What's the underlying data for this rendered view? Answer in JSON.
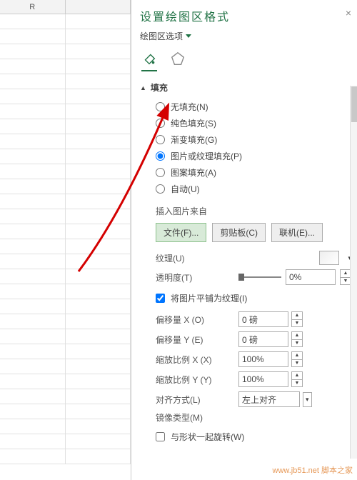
{
  "sheet": {
    "col_r": "R"
  },
  "pane": {
    "title": "设置绘图区格式",
    "subtitle": "绘图区选项",
    "close_glyph": "×",
    "section_fill": "填充",
    "section_toggle": "▲"
  },
  "fill_options": {
    "none": "无填充(N)",
    "solid": "纯色填充(S)",
    "gradient": "渐变填充(G)",
    "picture": "图片或纹理填充(P)",
    "pattern": "图案填充(A)",
    "auto": "自动(U)"
  },
  "insert": {
    "label": "插入图片来自",
    "file": "文件(F)...",
    "clipboard": "剪贴板(C)",
    "online": "联机(E)..."
  },
  "texture": {
    "label": "纹理(U)"
  },
  "transparency": {
    "label": "透明度(T)",
    "value": "0%"
  },
  "tile": {
    "label": "将图片平铺为纹理(I)",
    "checked": true
  },
  "offset_x": {
    "label": "偏移量 X (O)",
    "value": "0 磅"
  },
  "offset_y": {
    "label": "偏移量 Y (E)",
    "value": "0 磅"
  },
  "scale_x": {
    "label": "缩放比例 X (X)",
    "value": "100%"
  },
  "scale_y": {
    "label": "缩放比例 Y (Y)",
    "value": "100%"
  },
  "align": {
    "label": "对齐方式(L)",
    "value": "左上对齐"
  },
  "mirror": {
    "label": "镜像类型(M)"
  },
  "rotate": {
    "label": "与形状一起旋转(W)",
    "checked": false
  },
  "watermark": "www.jb51.net 脚本之家"
}
